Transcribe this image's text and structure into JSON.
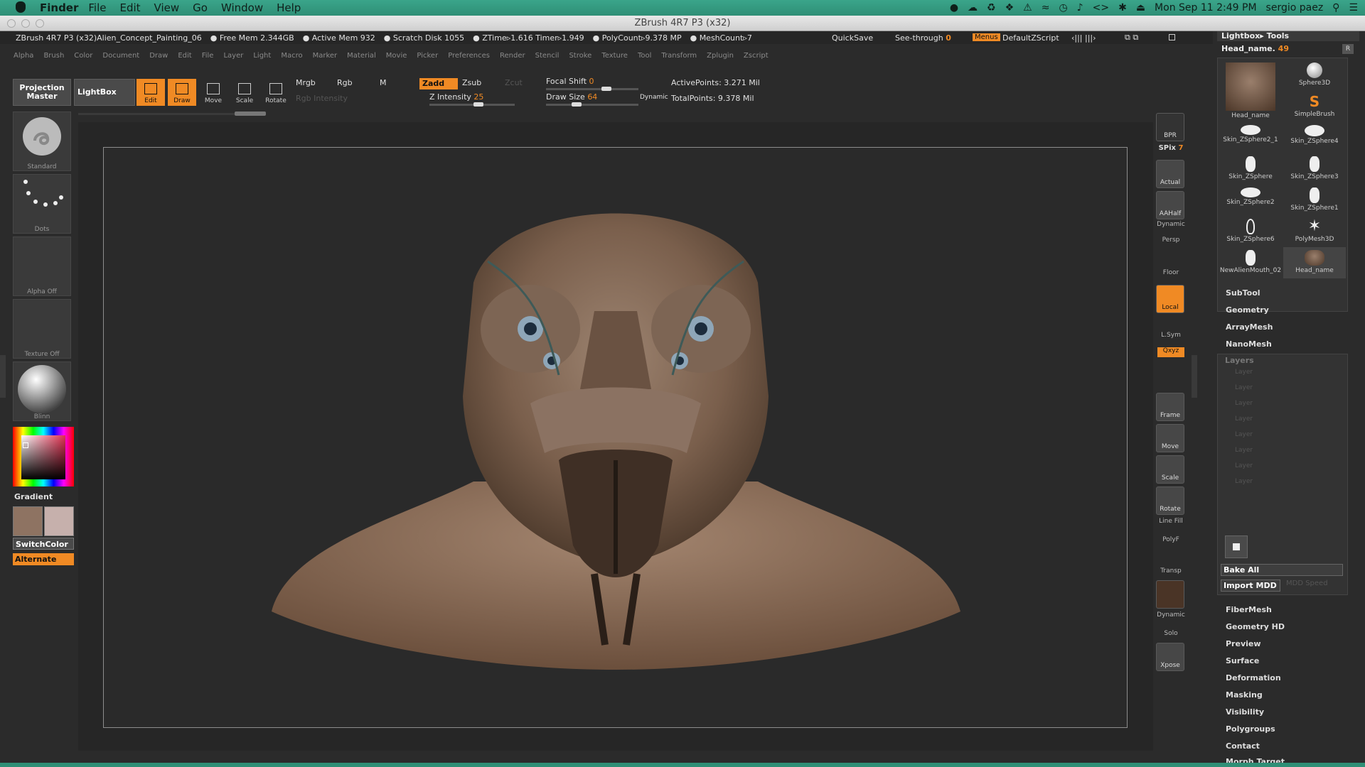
{
  "mac": {
    "app": "Finder",
    "menu": [
      "File",
      "Edit",
      "View",
      "Go",
      "Window",
      "Help"
    ],
    "clock": "Mon Sep 11  2:49 PM",
    "user": "sergio paez"
  },
  "window": {
    "title": "ZBrush 4R7 P3 (x32)"
  },
  "status": {
    "doc": "ZBrush 4R7 P3 (x32)Alien_Concept_Painting_06",
    "free_mem": "● Free Mem 2.344GB",
    "active_mem": "● Active Mem 932",
    "scratch": "● Scratch Disk 1055",
    "ztime": "● ZTime▹1.616 Timer▹1.949",
    "polycount": "● PolyCount▹9.378 MP",
    "meshcount": "● MeshCount▹7",
    "quicksave": "QuickSave",
    "seethrough": "See-through",
    "seethrough_val": "0",
    "menus": "Menus",
    "zscript": "DefaultZScript"
  },
  "menubar": [
    "Alpha",
    "Brush",
    "Color",
    "Document",
    "Draw",
    "Edit",
    "File",
    "Layer",
    "Light",
    "Macro",
    "Marker",
    "Material",
    "Movie",
    "Picker",
    "Preferences",
    "Render",
    "Stencil",
    "Stroke",
    "Texture",
    "Tool",
    "Transform",
    "Zplugin",
    "Zscript"
  ],
  "toolbar": {
    "projection": "Projection Master",
    "lightbox": "LightBox",
    "edit": "Edit",
    "draw": "Draw",
    "move": "Move",
    "scale": "Scale",
    "rotate": "Rotate",
    "mrgb": "Mrgb",
    "rgb": "Rgb",
    "m": "M",
    "rgb_intensity": "Rgb Intensity",
    "zadd": "Zadd",
    "zsub": "Zsub",
    "zcut": "Zcut",
    "z_intensity": "Z Intensity",
    "z_intensity_val": "25",
    "focal_shift": "Focal Shift",
    "focal_shift_val": "0",
    "draw_size": "Draw Size",
    "draw_size_val": "64",
    "dynamic": "Dynamic",
    "active_points": "ActivePoints: 3.271  Mil",
    "total_points": "TotalPoints: 9.378  Mil"
  },
  "leftshelf": {
    "brush": "Standard",
    "stroke": "Dots",
    "alpha": "Alpha  Off",
    "texture": "Texture  Off",
    "material": "Blinn",
    "gradient": "Gradient",
    "switchcolor": "SwitchColor",
    "alternate": "Alternate",
    "main_color": "#8e7362",
    "secondary_color": "#c6b0ac"
  },
  "rightshelf": {
    "bpr": "BPR",
    "spix": "SPix",
    "spix_val": "7",
    "actual": "Actual",
    "aahalf": "AAHalf",
    "dynamic": "Dynamic",
    "persp": "Persp",
    "floor": "Floor",
    "local": "Local",
    "lsym": "L.Sym",
    "xyz": "Qxyz",
    "frame": "Frame",
    "move": "Move",
    "scale": "Scale",
    "rotate": "Rotate",
    "linefill": "Line Fill",
    "polyf": "PolyF",
    "transp": "Transp",
    "dynamic2": "Dynamic",
    "solo": "Solo",
    "xpose": "Xpose"
  },
  "panel": {
    "header": "Lightbox▸ Tools",
    "headname": "Head_name.",
    "headname_val": "49",
    "r": "R",
    "tools": [
      "Head_name",
      "Sphere3D",
      "SimpleBrush",
      "Skin_ZSphere2_1",
      "Skin_ZSphere4",
      "Skin_ZSphere",
      "Skin_ZSphere3",
      "Skin_ZSphere2",
      "Skin_ZSphere1",
      "Skin_ZSphere6",
      "PolyMesh3D",
      "NewAlienMouth_02",
      "Head_name"
    ],
    "sections_top": [
      "SubTool",
      "Geometry",
      "ArrayMesh",
      "NanoMesh"
    ],
    "layers": "Layers",
    "layer_item": "Layer",
    "bake": "Bake All",
    "import": "Import MDD",
    "mdd_speed": "MDD Speed",
    "sections_bottom": [
      "FiberMesh",
      "Geometry HD",
      "Preview",
      "Surface",
      "Deformation",
      "Masking",
      "Visibility",
      "Polygroups",
      "Contact",
      "Morph Target"
    ]
  }
}
